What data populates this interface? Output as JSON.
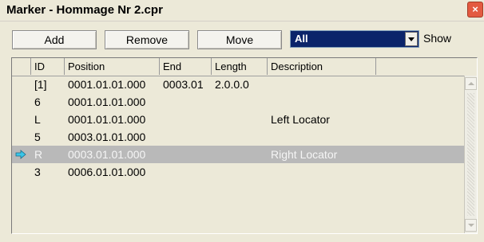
{
  "window": {
    "title": "Marker - Hommage Nr 2.cpr",
    "close_glyph": "×"
  },
  "toolbar": {
    "add_label": "Add",
    "remove_label": "Remove",
    "move_label": "Move",
    "filter_value": "All",
    "show_label": "Show"
  },
  "list": {
    "columns": {
      "id": "ID",
      "position": "Position",
      "end": "End",
      "length": "Length",
      "description": "Description"
    },
    "rows": [
      {
        "id": "[1]",
        "position": "0001.01.01.000",
        "end": "0003.01",
        "length": "2.0.0.0",
        "description": ""
      },
      {
        "id": "6",
        "position": "0001.01.01.000",
        "end": "",
        "length": "",
        "description": ""
      },
      {
        "id": "L",
        "position": "0001.01.01.000",
        "end": "",
        "length": "",
        "description": "Left Locator"
      },
      {
        "id": "5",
        "position": "0003.01.01.000",
        "end": "",
        "length": "",
        "description": ""
      },
      {
        "id": "R",
        "position": "0003.01.01.000",
        "end": "",
        "length": "",
        "description": "Right Locator"
      },
      {
        "id": "3",
        "position": "0006.01.01.000",
        "end": "",
        "length": "",
        "description": ""
      }
    ],
    "selected_row_index": 4,
    "current_marker_icon": "arrow-right-icon"
  },
  "colors": {
    "selection": "#b9b9b9",
    "filter_bg": "#0b246a",
    "marker_arrow": "#39c6e8"
  }
}
